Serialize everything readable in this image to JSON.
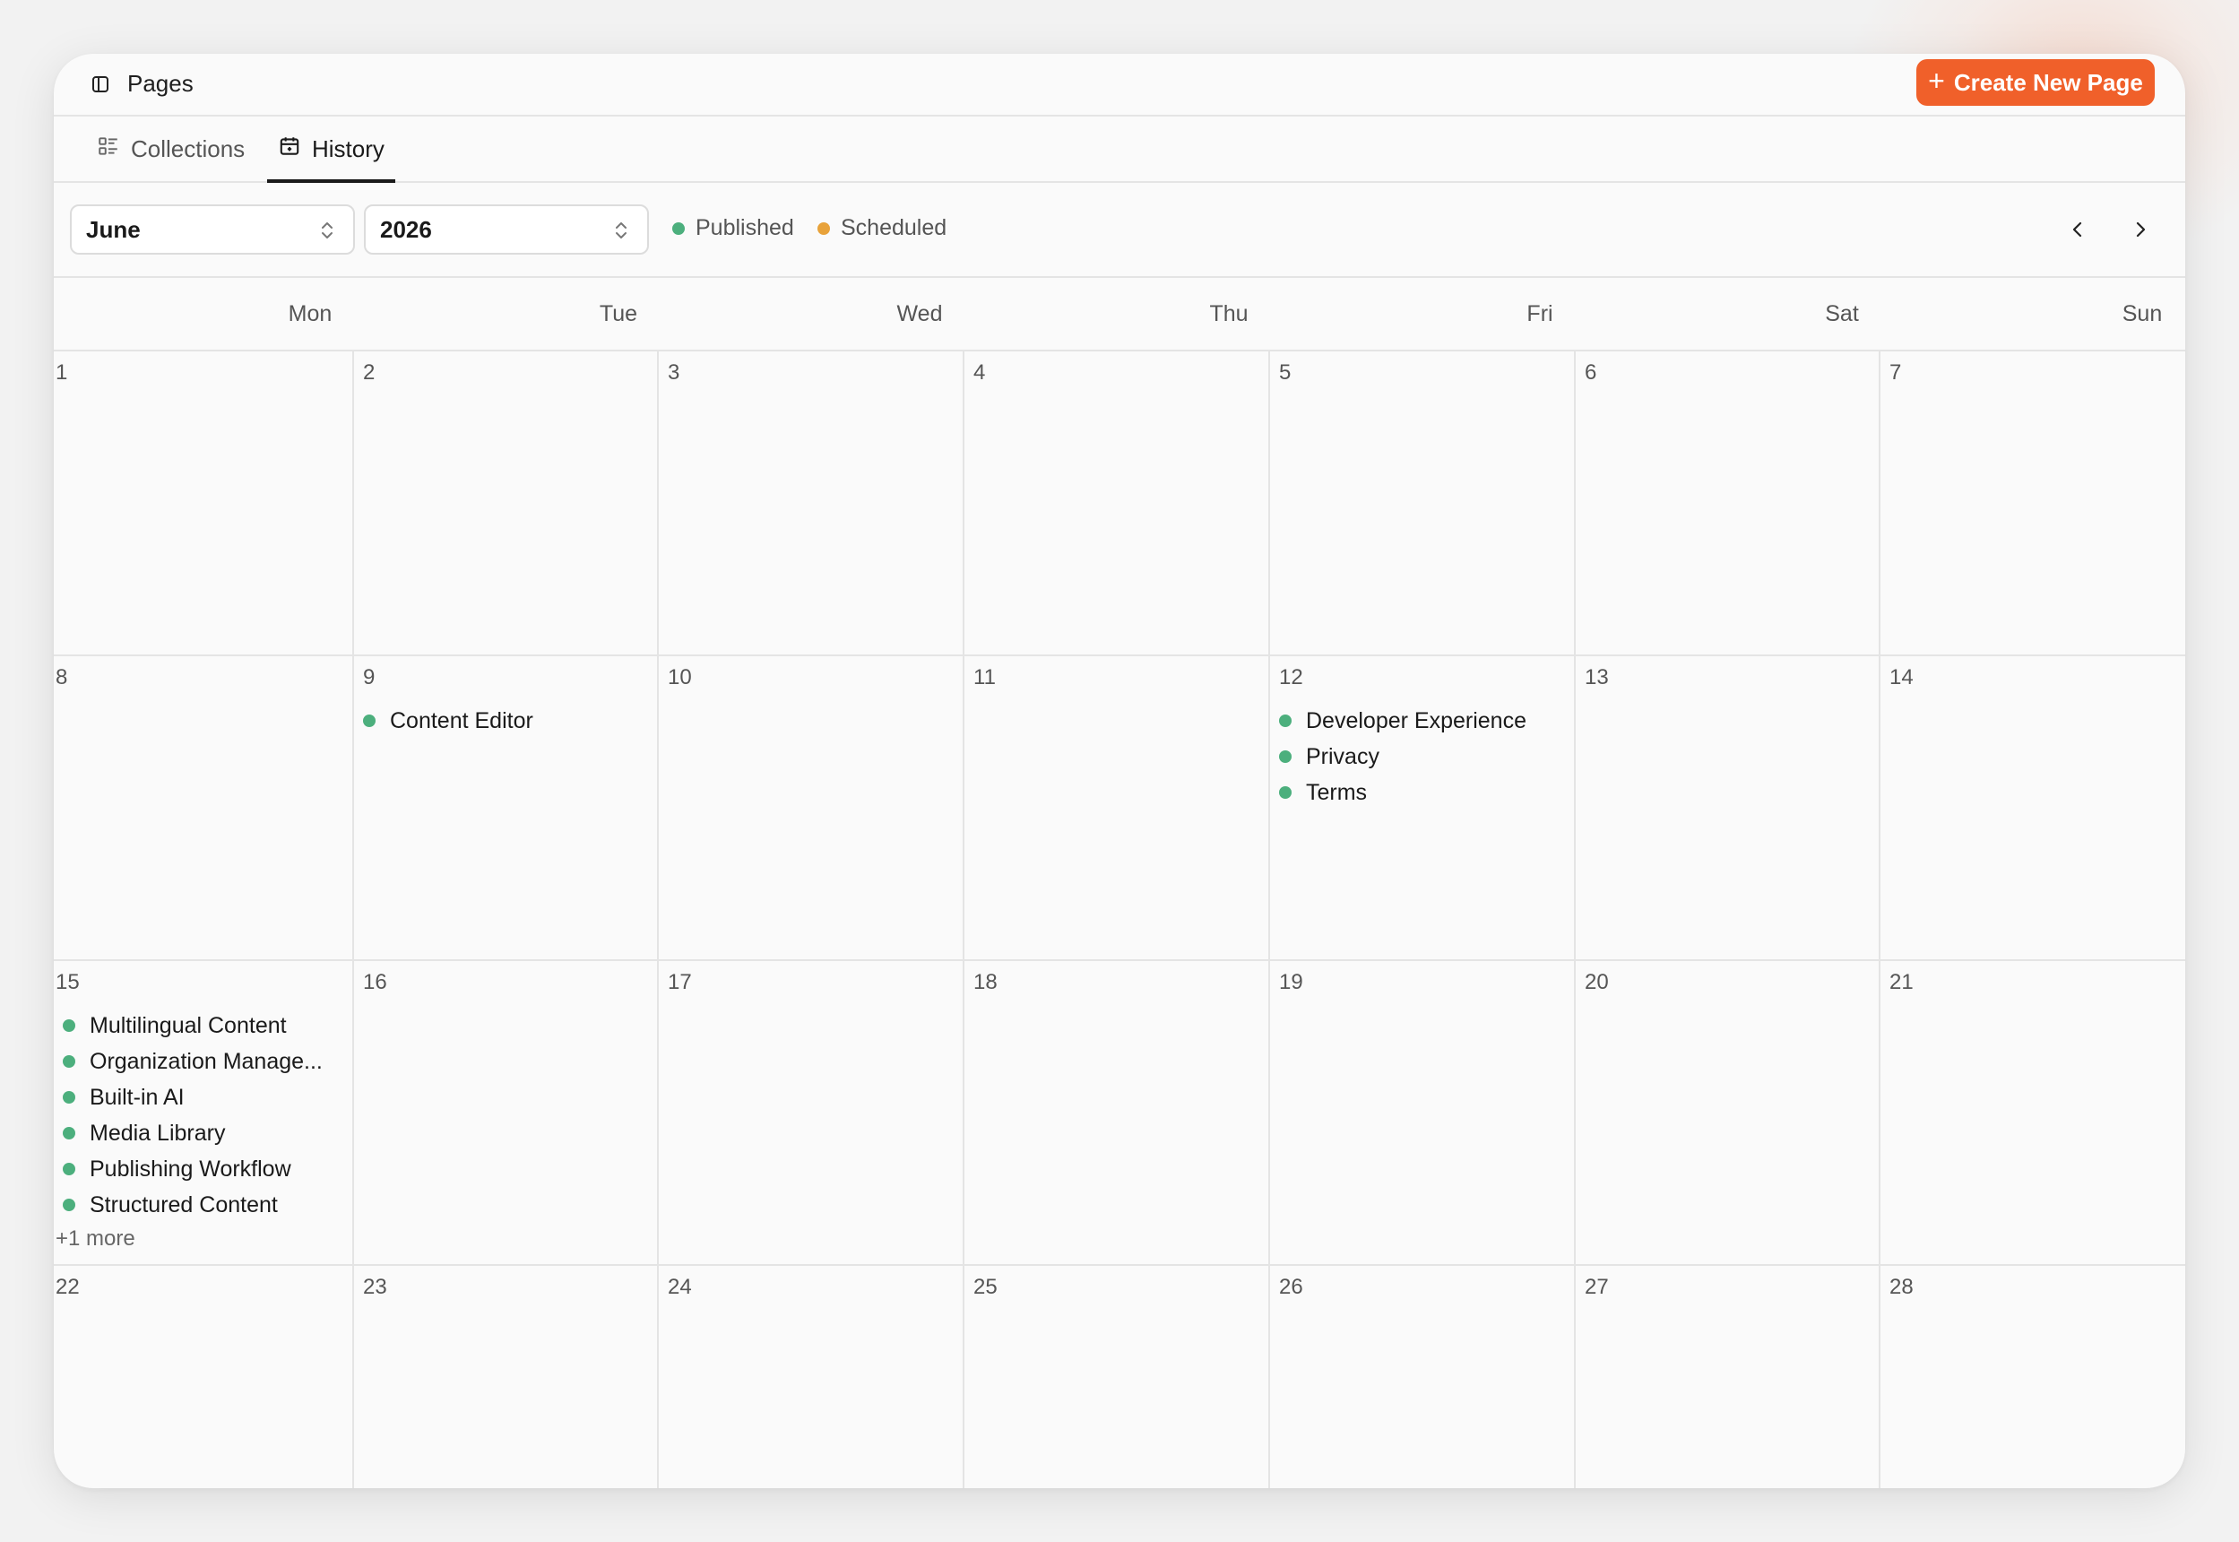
{
  "header": {
    "title": "Pages",
    "create_label": "Create New Page"
  },
  "tabs": [
    {
      "label": "Collections",
      "active": false
    },
    {
      "label": "History",
      "active": true
    }
  ],
  "filters": {
    "month": "June",
    "year": "2026",
    "legend": [
      {
        "label": "Published",
        "color": "#4caf7d"
      },
      {
        "label": "Scheduled",
        "color": "#e8a23a"
      }
    ]
  },
  "colors": {
    "accent": "#f0602a",
    "published": "#4caf7d",
    "scheduled": "#e8a23a"
  },
  "calendar": {
    "weekdays": [
      "Mon",
      "Tue",
      "Wed",
      "Thu",
      "Fri",
      "Sat",
      "Sun"
    ],
    "weeks": [
      [
        {
          "day": "1",
          "events": []
        },
        {
          "day": "2",
          "events": []
        },
        {
          "day": "3",
          "events": []
        },
        {
          "day": "4",
          "events": []
        },
        {
          "day": "5",
          "events": []
        },
        {
          "day": "6",
          "events": []
        },
        {
          "day": "7",
          "events": []
        }
      ],
      [
        {
          "day": "8",
          "events": []
        },
        {
          "day": "9",
          "events": [
            {
              "title": "Content Editor",
              "status": "published"
            }
          ]
        },
        {
          "day": "10",
          "events": []
        },
        {
          "day": "11",
          "events": []
        },
        {
          "day": "12",
          "events": [
            {
              "title": "Developer Experience",
              "status": "published"
            },
            {
              "title": "Privacy",
              "status": "published"
            },
            {
              "title": "Terms",
              "status": "published"
            }
          ]
        },
        {
          "day": "13",
          "events": []
        },
        {
          "day": "14",
          "events": []
        }
      ],
      [
        {
          "day": "15",
          "events": [
            {
              "title": "Multilingual Content",
              "status": "published"
            },
            {
              "title": "Organization Manage...",
              "status": "published"
            },
            {
              "title": "Built-in AI",
              "status": "published"
            },
            {
              "title": "Media Library",
              "status": "published"
            },
            {
              "title": "Publishing Workflow",
              "status": "published"
            },
            {
              "title": "Structured Content",
              "status": "published"
            }
          ],
          "more": "+1 more"
        },
        {
          "day": "16",
          "events": []
        },
        {
          "day": "17",
          "events": []
        },
        {
          "day": "18",
          "events": []
        },
        {
          "day": "19",
          "events": []
        },
        {
          "day": "20",
          "events": []
        },
        {
          "day": "21",
          "events": []
        }
      ],
      [
        {
          "day": "22",
          "events": []
        },
        {
          "day": "23",
          "events": []
        },
        {
          "day": "24",
          "events": []
        },
        {
          "day": "25",
          "events": []
        },
        {
          "day": "26",
          "events": []
        },
        {
          "day": "27",
          "events": []
        },
        {
          "day": "28",
          "events": []
        }
      ]
    ]
  }
}
